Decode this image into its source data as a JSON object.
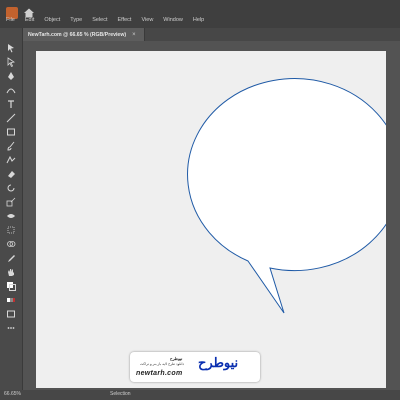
{
  "menubar": {
    "items": [
      "File",
      "Edit",
      "Object",
      "Type",
      "Select",
      "Effect",
      "View",
      "Window",
      "Help"
    ]
  },
  "document_tab": {
    "label": "NewTarh.com @ 66.65 % (RGB/Preview)",
    "close_glyph": "×"
  },
  "status": {
    "zoom": "66.65%",
    "field": "Selection"
  },
  "artwork": {
    "shape": "speech-bubble",
    "stroke_color": "#1f5aa6",
    "fill_color": "#ffffff",
    "artboard_color": "#efefef"
  },
  "watermark": {
    "brand": "نیوطرح",
    "name_small": "نیوطرح",
    "tagline": "دانلود طرح لایه باز بنر و تراکت",
    "domain": "newtarh.com"
  },
  "toolbar": {
    "tools": [
      "selection-tool",
      "direct-selection-tool",
      "pen-tool",
      "curvature-tool",
      "type-tool",
      "line-tool",
      "rectangle-tool",
      "paintbrush-tool",
      "shaper-tool",
      "eraser-tool",
      "rotate-tool",
      "scale-tool",
      "width-tool",
      "free-transform-tool",
      "shape-builder-tool",
      "perspective-grid-tool",
      "mesh-tool",
      "gradient-tool",
      "eyedropper-tool",
      "blend-tool",
      "symbol-sprayer-tool",
      "graph-tool",
      "artboard-tool",
      "slice-tool",
      "hand-tool",
      "zoom-tool"
    ]
  }
}
